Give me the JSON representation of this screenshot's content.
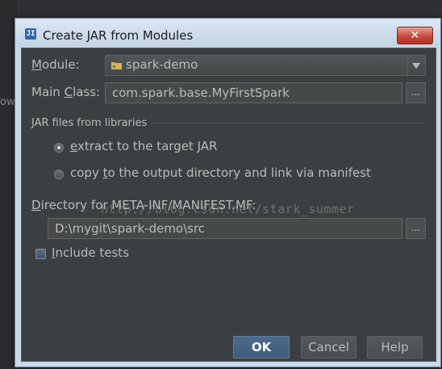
{
  "background": {
    "partial_text": "ow"
  },
  "dialog": {
    "title": "Create JAR from Modules",
    "icon_text": "JI",
    "close_symbol": "✕"
  },
  "module": {
    "label_pre": "",
    "label_key": "M",
    "label_post": "odule:",
    "value": "spark-demo"
  },
  "main_class": {
    "label_pre": "Main ",
    "label_key": "C",
    "label_post": "lass:",
    "value": "com.spark.base.MyFirstSpark",
    "browse_label": "..."
  },
  "jar_section": {
    "title": "JAR files from libraries",
    "option_extract": {
      "pre": "",
      "key": "e",
      "post": "xtract to the target JAR",
      "selected": true
    },
    "option_copy": {
      "pre": "copy ",
      "key": "t",
      "post": "o the output directory and link via manifest",
      "selected": false
    }
  },
  "manifest_dir": {
    "label_pre": "",
    "label_key": "D",
    "label_post": "irectory for META-INF/MANIFEST.MF:",
    "value": "D:\\mygit\\spark-demo\\src",
    "browse_label": "..."
  },
  "include_tests": {
    "pre": "",
    "key": "I",
    "post": "nclude tests",
    "checked": false
  },
  "watermark": "http://blog.csdn.net/stark_summer",
  "buttons": {
    "ok": "OK",
    "cancel": "Cancel",
    "help": "Help"
  },
  "colors": {
    "panel_bg": "#3c3f41",
    "title_bar": "#c9d8e8",
    "close_red": "#c84a3a",
    "default_button": "#4c6a8b"
  }
}
